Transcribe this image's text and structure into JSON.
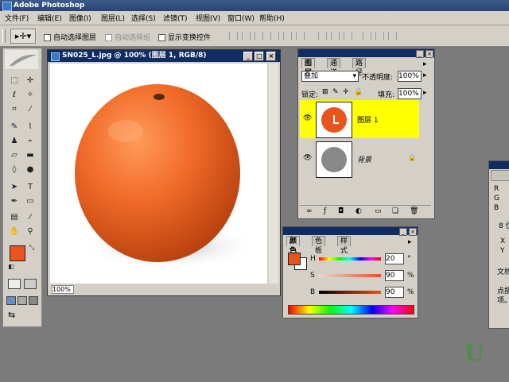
{
  "app": {
    "title": "Adobe Photoshop"
  },
  "menu": [
    "文件(F)",
    "编辑(E)",
    "图像(I)",
    "图层(L)",
    "选择(S)",
    "滤镜(T)",
    "视图(V)",
    "窗口(W)",
    "帮助(H)"
  ],
  "options": {
    "auto_select_layer": "自动选择图层",
    "auto_select_group": "自动选择组",
    "show_transform": "显示变换控件"
  },
  "document": {
    "title": "SN025_L.jpg @ 100% (图层 1, RGB/8)",
    "zoom": "100%"
  },
  "layers_panel": {
    "tabs": [
      "图层",
      "通道",
      "路径"
    ],
    "blend_mode": "叠加",
    "opacity_label": "不透明度:",
    "opacity": "100%",
    "lock_label": "锁定:",
    "fill_label": "填充:",
    "fill": "100%",
    "layers": [
      {
        "name": "图层 1",
        "selected": true
      },
      {
        "name": "背景",
        "selected": false,
        "locked": true
      }
    ]
  },
  "color_panel": {
    "tabs": [
      "颜色",
      "色板",
      "样式"
    ],
    "channels": [
      {
        "label": "H",
        "value": "20",
        "unit": "°"
      },
      {
        "label": "S",
        "value": "90",
        "unit": "%"
      },
      {
        "label": "B",
        "value": "90",
        "unit": "%"
      }
    ],
    "foreground": "#e8541c"
  },
  "info_panel": {
    "letters": [
      "R",
      "G",
      "B",
      "8 位",
      "X",
      "Y",
      "文档",
      "点按",
      "项。"
    ]
  },
  "watermark": "U"
}
